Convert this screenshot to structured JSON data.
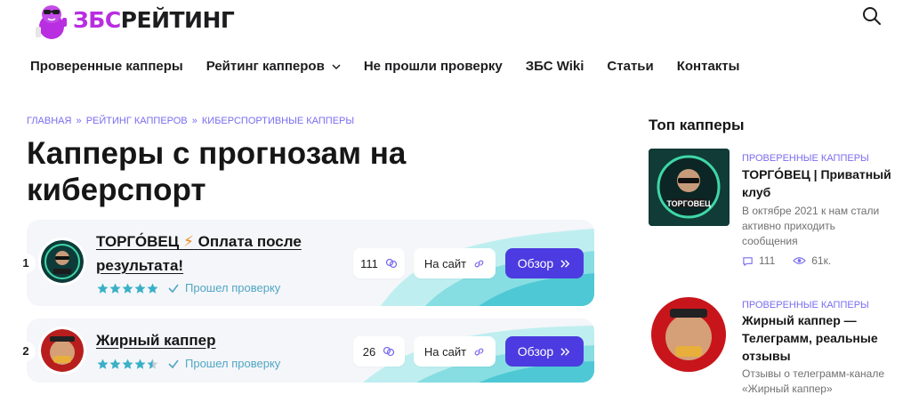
{
  "header": {
    "logo_part1": "ЗБС",
    "logo_part2": "РЕЙТИНГ",
    "search_icon": "search-icon"
  },
  "nav": {
    "items": [
      {
        "label": "Проверенные капперы"
      },
      {
        "label": "Рейтинг капперов"
      },
      {
        "label": "Не прошли проверку"
      },
      {
        "label": "ЗБС Wiki"
      },
      {
        "label": "Статьи"
      },
      {
        "label": "Контакты"
      }
    ]
  },
  "breadcrumb": {
    "items": [
      "ГЛАВНАЯ",
      "РЕЙТИНГ КАППЕРОВ",
      "КИБЕРСПОРТИВНЫЕ КАППЕРЫ"
    ],
    "separator": "»"
  },
  "page": {
    "title": "Капперы с прогнозам на киберспорт"
  },
  "cards": [
    {
      "rank": "1",
      "title_line1": "ТОРГО́ВЕЦ",
      "title_bolt": "⚡",
      "title_line1b": "Оплата после",
      "title_line2": "результата!",
      "rating": 5,
      "verified_label": "Прошел проверку",
      "comments": "111",
      "site_label": "На сайт",
      "review_label": "Обзор"
    },
    {
      "rank": "2",
      "title_line1": "Жирный каппер",
      "rating": 4.5,
      "verified_label": "Прошел проверку",
      "comments": "26",
      "site_label": "На сайт",
      "review_label": "Обзор"
    }
  ],
  "sidebar": {
    "title": "Топ капперы",
    "items": [
      {
        "category": "ПРОВЕРЕННЫЕ КАППЕРЫ",
        "headline": "ТОРГО́ВЕЦ | Приватный клуб",
        "desc": "В октябре 2021 к нам стали активно приходить сообщения",
        "comments": "111",
        "views": "61к."
      },
      {
        "category": "ПРОВЕРЕННЫЕ КАППЕРЫ",
        "headline": "Жирный каппер — Телеграмм, реальные отзывы",
        "desc": "Отзывы о телеграмм-канале «Жирный каппер»"
      }
    ]
  },
  "colors": {
    "accent": "#4c3be0",
    "brand_pink": "#b82ee0",
    "link_purple": "#7b6cf0",
    "verified_blue": "#52a6c4",
    "star_teal": "#3ab0c8"
  }
}
